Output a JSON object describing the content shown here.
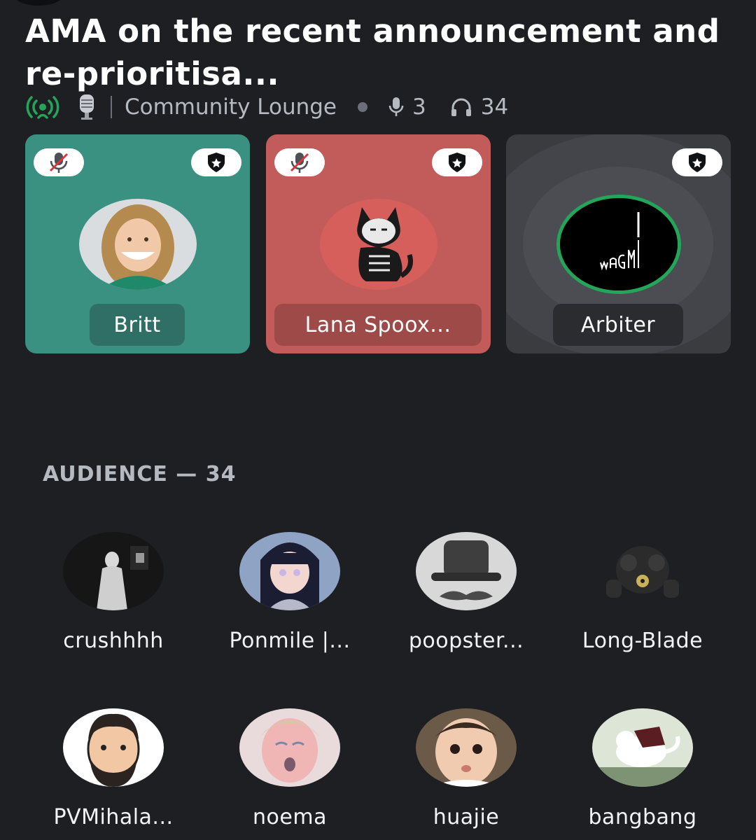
{
  "stage": {
    "title": "AMA on the recent announcement and re-prioritisa...",
    "channel": "Community Lounge",
    "speaker_count": "3",
    "listener_count": "34",
    "icons": [
      "live-stage-icon",
      "microphone-stand-icon",
      "microphone-icon",
      "headphones-icon"
    ]
  },
  "speakers": [
    {
      "name": "Britt",
      "muted": true,
      "moderator": true,
      "color": "#3a9182"
    },
    {
      "name": "Lana Spoox...",
      "muted": true,
      "moderator": true,
      "color": "#c25c5a"
    },
    {
      "name": "Arbiter",
      "muted": false,
      "moderator": true,
      "speaking": true,
      "color": "#3b3c40"
    }
  ],
  "audience": {
    "header": "AUDIENCE — 34",
    "members": [
      {
        "name": "crushhhh"
      },
      {
        "name": "Ponmile |..."
      },
      {
        "name": "poopster..."
      },
      {
        "name": "Long-Blade"
      },
      {
        "name": "PVMihala..."
      },
      {
        "name": "noema"
      },
      {
        "name": "huajie"
      },
      {
        "name": "bangbang"
      }
    ]
  },
  "colors": {
    "background": "#1e1f22",
    "live_green": "#23a55a",
    "speaking_ring": "#23a55a"
  }
}
